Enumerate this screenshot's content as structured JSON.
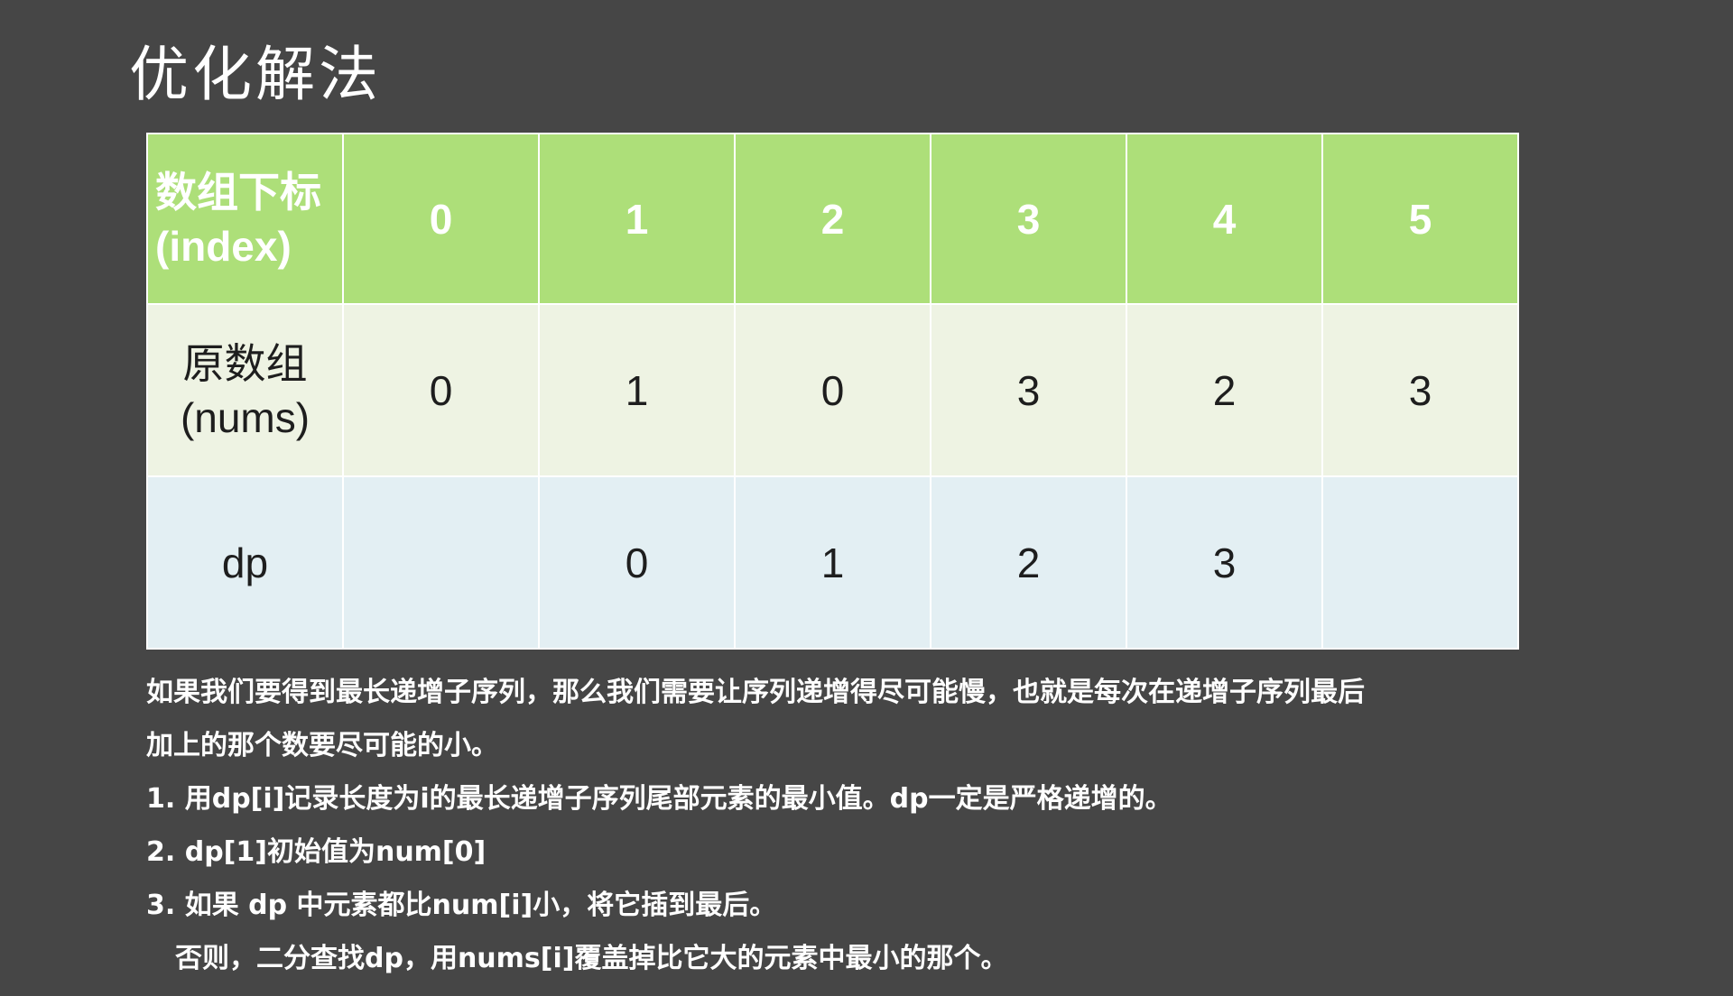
{
  "title": "优化解法",
  "table": {
    "header": {
      "label_line1": "数组下标",
      "label_line2": "(index)",
      "cells": [
        "0",
        "1",
        "2",
        "3",
        "4",
        "5"
      ]
    },
    "nums": {
      "label_line1": "原数组",
      "label_line2": "(nums)",
      "cells": [
        "0",
        "1",
        "0",
        "3",
        "2",
        "3"
      ]
    },
    "dp": {
      "label": "dp",
      "cells": [
        "",
        "0",
        "1",
        "2",
        "3",
        ""
      ]
    },
    "colors": {
      "header_bg": "#addf79",
      "nums_bg": "#eef3e3",
      "dp_bg": "#e3eff3",
      "page_bg": "#464646"
    }
  },
  "notes": [
    "如果我们要得到最长递增子序列，那么我们需要让序列递增得尽可能慢，也就是每次在递增子序列最后",
    "加上的那个数要尽可能的小。",
    "1. 用dp[i]记录长度为i的最长递增子序列尾部元素的最小值。dp一定是严格递增的。",
    "2. dp[1]初始值为num[0]",
    "3. 如果 dp 中元素都比num[i]小，将它插到最后。",
    "否则，二分查找dp，用nums[i]覆盖掉比它大的元素中最小的那个。"
  ]
}
